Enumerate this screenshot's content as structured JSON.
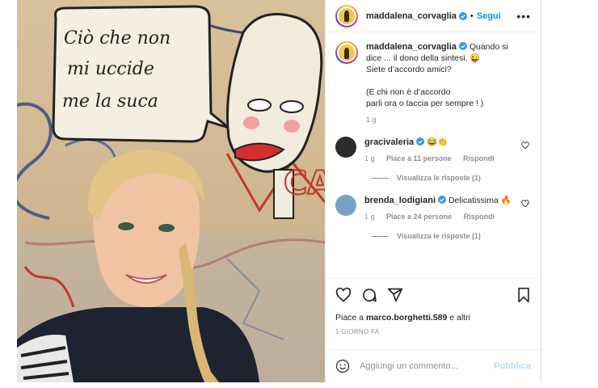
{
  "post": {
    "username": "maddalena_corvaglia",
    "separator": "•",
    "follow_label": "Segui",
    "more_label": "•••",
    "image_alt": "Selfie davanti a un murale con scritta",
    "mural_text_line1": "Ciò che non",
    "mural_text_line2": "mi uccide",
    "mural_text_line3": "me la suca",
    "mural_tag": "CAB"
  },
  "caption": {
    "username": "maddalena_corvaglia",
    "line1": "Quando si",
    "line2": "dice ... il dono della sintesi. 😜",
    "line3": "Siete d’accordo amici?",
    "line4": "(E chi non è d’accordo",
    "line5": "parli ora o taccia per sempre ! )",
    "time": "1 g"
  },
  "comments": [
    {
      "username": "gracivaleria",
      "text": "😂👏",
      "time": "1 g",
      "likes": "Piace a 11 persone",
      "reply": "Rispondi",
      "view_replies": "Visualizza le risposte (1)",
      "avatar_color": "#2b2b2b"
    },
    {
      "username": "brenda_lodigiani",
      "text": "Delicatissima 🔥",
      "time": "1 g",
      "likes": "Piace a 24 persone",
      "reply": "Rispondi",
      "view_replies": "Visualizza le risposte (1)",
      "avatar_color": "#7aa0c4"
    }
  ],
  "actions": {
    "icons": [
      "heart-icon",
      "comment-icon",
      "share-icon",
      "bookmark-icon"
    ],
    "likes_prefix": "Piace a ",
    "likes_user": "marco.borghetti.589",
    "likes_suffix": " e altri",
    "date": "1 GIORNO FA"
  },
  "add_comment": {
    "placeholder": "Aggiungi un commento...",
    "publish_label": "Pubblica"
  },
  "colors": {
    "accent": "#0095f6",
    "verified": "#3897f0",
    "muted": "#8e8e8e",
    "publish_disabled": "#b2dffc"
  }
}
